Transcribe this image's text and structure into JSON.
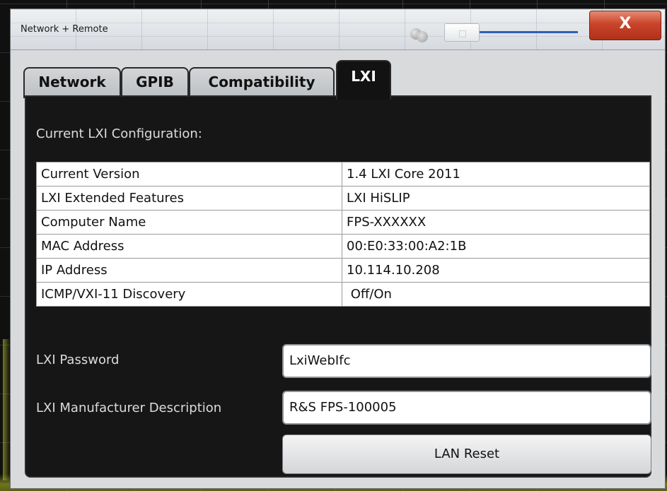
{
  "window": {
    "title": "Network + Remote",
    "close_label": "X"
  },
  "tabs": [
    {
      "label": "Network",
      "active": false
    },
    {
      "label": "GPIB",
      "active": false
    },
    {
      "label": "Compatibility",
      "active": false
    },
    {
      "label": "LXI",
      "active": true
    }
  ],
  "lxi": {
    "section_title": "Current LXI Configuration:",
    "rows": [
      {
        "key": "Current Version",
        "value": "1.4 LXI Core 2011"
      },
      {
        "key": "LXI Extended Features",
        "value": "LXI HiSLIP"
      },
      {
        "key": "Computer Name",
        "value": "FPS-XXXXXX"
      },
      {
        "key": "MAC Address",
        "value": "00:E0:33:00:A2:1B"
      },
      {
        "key": "IP Address",
        "value": "10.114.10.208"
      },
      {
        "key": "ICMP/VXI-11 Discovery",
        "value": " Off/On"
      }
    ],
    "password_label": "LXI Password",
    "password_value": "LxiWebIfc",
    "manufacturer_label": "LXI Manufacturer Description",
    "manufacturer_value": "R&S FPS-100005",
    "lan_reset_label": "LAN Reset"
  },
  "icons": {
    "close": "close-icon",
    "transparency_slider": "slider-icon",
    "dots": "dots-icon"
  },
  "colors": {
    "close_button": "#c9442a",
    "active_tab_bg": "#121212",
    "panel_bg": "#161616",
    "slider_accent": "#2d5fb8"
  }
}
